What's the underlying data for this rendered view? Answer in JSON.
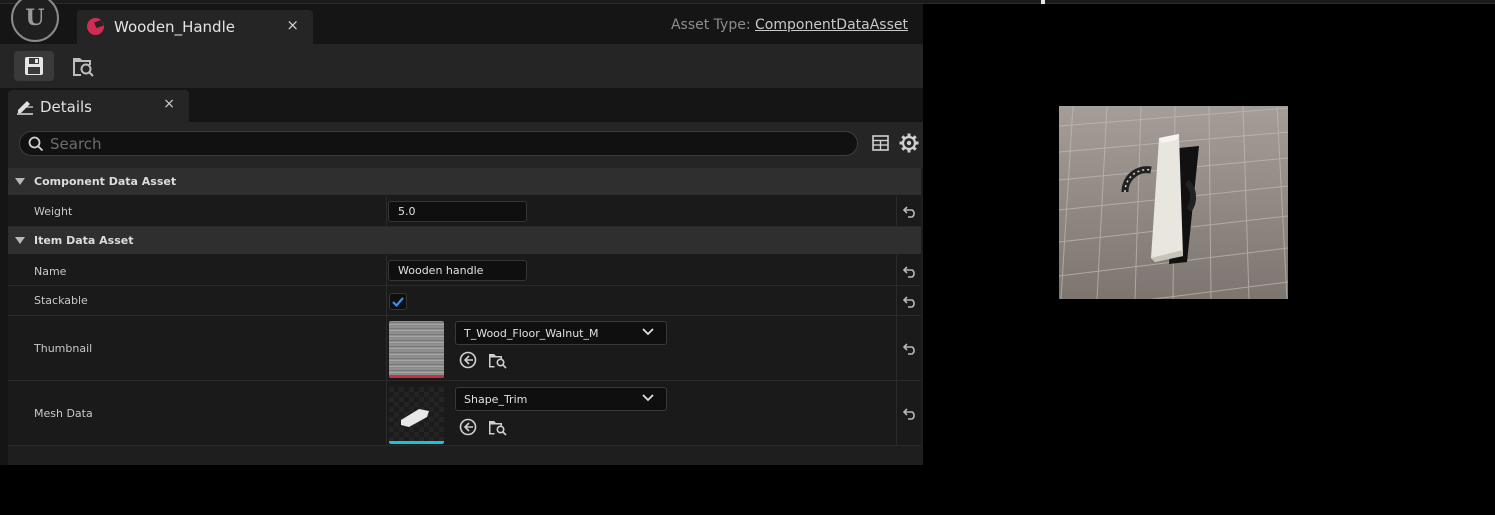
{
  "tab": {
    "title": "Wooden_Handle",
    "close_glyph": "×"
  },
  "asset_type": {
    "label": "Asset Type:",
    "value": "ComponentDataAsset"
  },
  "toolbar": {
    "save_icon": "save-icon",
    "browse_icon": "browse-to-asset-icon"
  },
  "details_panel": {
    "tab_label": "Details",
    "close_glyph": "×",
    "search": {
      "placeholder": "Search",
      "value": ""
    }
  },
  "categories": [
    {
      "label": "Component Data Asset"
    },
    {
      "label": "Item Data Asset"
    }
  ],
  "properties": {
    "weight": {
      "name": "Weight",
      "value": "5.0"
    },
    "name": {
      "name": "Name",
      "value": "Wooden handle"
    },
    "stackable": {
      "name": "Stackable",
      "checked": true
    },
    "thumbnail": {
      "name": "Thumbnail",
      "asset": "T_Wood_Floor_Walnut_M"
    },
    "mesh_data": {
      "name": "Mesh Data",
      "asset": "Shape_Trim"
    }
  },
  "colors": {
    "accent_asset_icon": "#d12c54",
    "checkbox_check": "#3c8ee8",
    "texture_bar": "#c8313f",
    "mesh_bar": "#18c3d9"
  }
}
